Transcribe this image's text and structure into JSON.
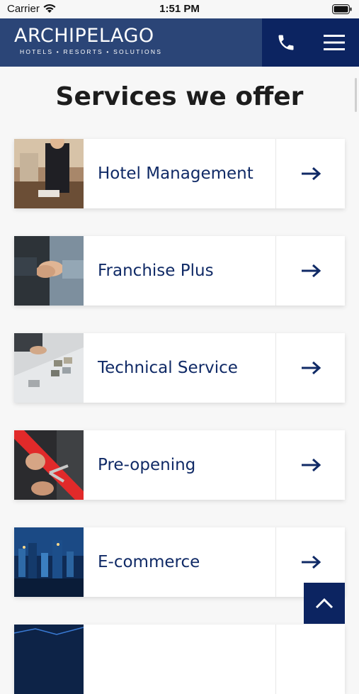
{
  "status": {
    "carrier": "Carrier",
    "time": "1:51 PM"
  },
  "header": {
    "brand": "ARCHIPELAGO",
    "tagline": "HOTELS • RESORTS • SOLUTIONS"
  },
  "page": {
    "title": "Services we offer"
  },
  "services": [
    {
      "label": "Hotel Management",
      "thumb": "business-woman-photo"
    },
    {
      "label": "Franchise Plus",
      "thumb": "handshake-photo"
    },
    {
      "label": "Technical Service",
      "thumb": "floor-plan-photo"
    },
    {
      "label": "Pre-opening",
      "thumb": "ribbon-cutting-photo"
    },
    {
      "label": "E-commerce",
      "thumb": "city-night-photo"
    },
    {
      "label": "",
      "thumb": "blue-tech-photo"
    }
  ],
  "icons": {
    "call": "phone-icon",
    "menu": "hamburger-menu-icon",
    "arrow": "arrow-right-icon",
    "top": "chevron-up-icon"
  },
  "colors": {
    "brand_blue": "#2b4577",
    "navy": "#0c2461",
    "text_navy": "#102a66"
  }
}
